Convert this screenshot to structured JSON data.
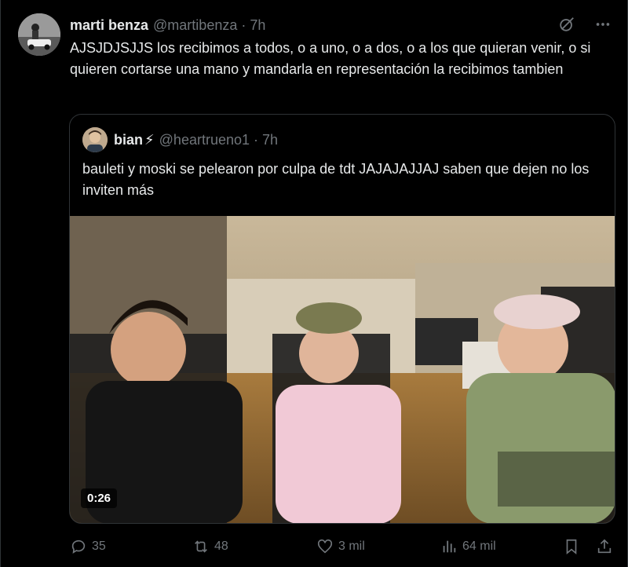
{
  "author": {
    "name": "marti benza",
    "handle": "@martibenza",
    "separator": "·",
    "time": "7h"
  },
  "tweet": {
    "text": "AJSJDJSJJS los recibimos a todos, o a uno, o a dos, o a los que quieran venir, o si quieren cortarse una mano y mandarla en representación la recibimos tambien"
  },
  "quote": {
    "name": "bian",
    "badge": "⚡",
    "handle": "@heartrueno1",
    "separator": "·",
    "time": "7h",
    "text": "bauleti y moski se pelearon por culpa de tdt JAJAJAJJAJ saben que dejen no los inviten más",
    "video_duration": "0:26"
  },
  "actions": {
    "replies": "35",
    "reposts": "48",
    "likes": "3 mil",
    "views": "64 mil"
  },
  "icons": {
    "top": [
      "grok-icon",
      "more-icon"
    ],
    "actions": [
      "reply-icon",
      "repost-icon",
      "like-icon",
      "views-icon",
      "bookmark-icon",
      "share-icon"
    ]
  },
  "colors": {
    "background": "#000000",
    "text": "#e7e9ea",
    "secondary": "#71767b",
    "border": "#2f3336"
  }
}
